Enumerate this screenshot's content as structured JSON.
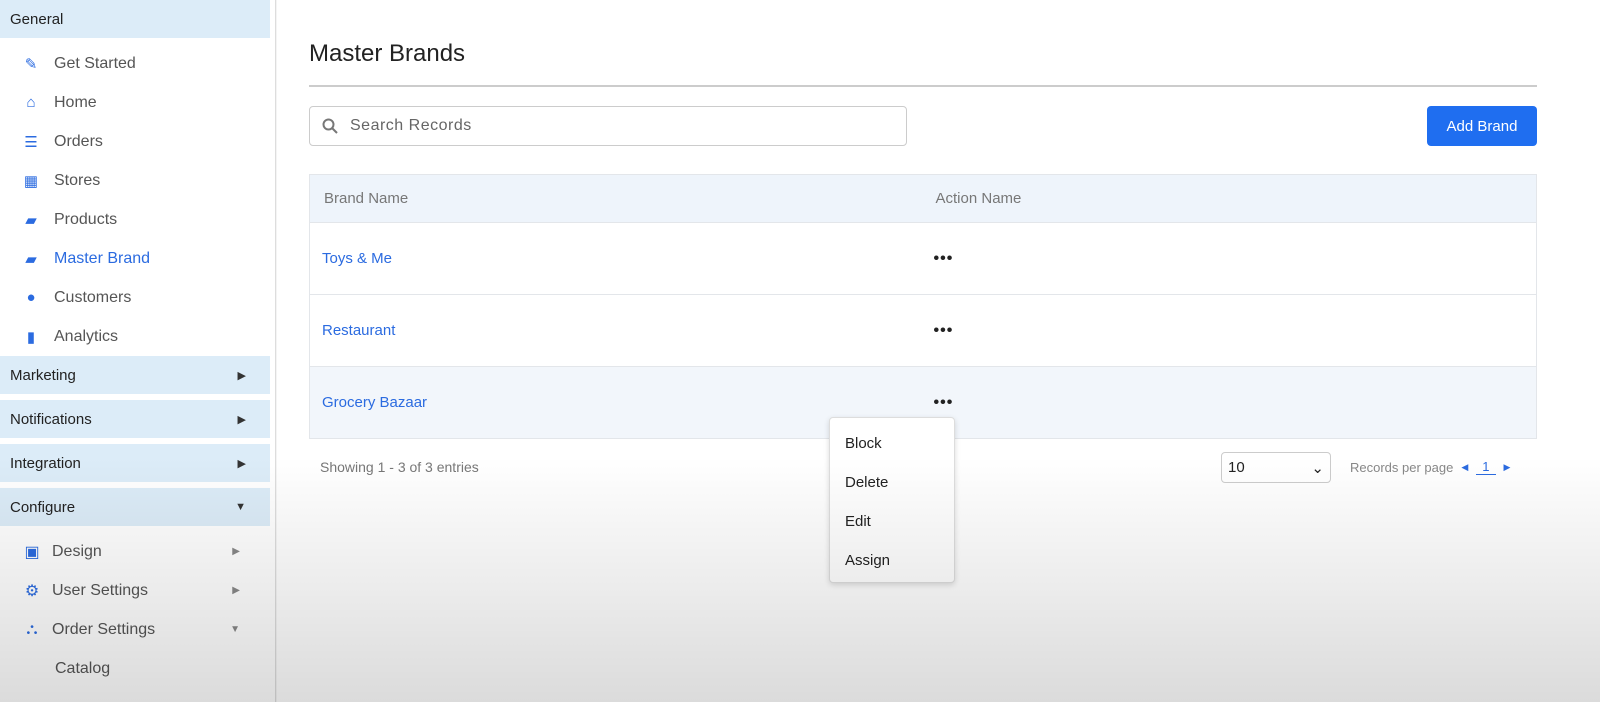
{
  "sidebar": {
    "general": "General",
    "items": [
      {
        "label": "Get Started",
        "icon": "edit-icon"
      },
      {
        "label": "Home",
        "icon": "home-icon"
      },
      {
        "label": "Orders",
        "icon": "orders-icon"
      },
      {
        "label": "Stores",
        "icon": "store-icon"
      },
      {
        "label": "Products",
        "icon": "products-icon"
      },
      {
        "label": "Master Brand",
        "icon": "brand-icon",
        "active": true
      },
      {
        "label": "Customers",
        "icon": "user-icon"
      },
      {
        "label": "Analytics",
        "icon": "analytics-icon"
      }
    ],
    "sections": [
      "Marketing",
      "Notifications",
      "Integration",
      "Configure"
    ],
    "configure_items": [
      {
        "label": "Design",
        "icon": "monitor-icon"
      },
      {
        "label": "User Settings",
        "icon": "gear-user-icon"
      },
      {
        "label": "Order Settings",
        "icon": "flow-icon"
      }
    ],
    "catalog": "Catalog"
  },
  "main": {
    "title": "Master Brands",
    "search_placeholder": "Search Records",
    "add_button": "Add Brand",
    "columns": [
      "Brand Name",
      "Action Name"
    ],
    "rows": [
      {
        "name": "Toys & Me",
        "action": "•••"
      },
      {
        "name": "Restaurant",
        "action": "•••"
      },
      {
        "name": "Grocery Bazaar",
        "action": "•••"
      }
    ],
    "showing": "Showing 1 - 3 of 3 entries",
    "per_page": "10",
    "records_per_page": "Records per page",
    "page": "1"
  },
  "menu": [
    "Block",
    "Delete",
    "Edit",
    "Assign"
  ],
  "colors": {
    "accent": "#1f6ef0",
    "section_bg": "#dcecf8"
  }
}
